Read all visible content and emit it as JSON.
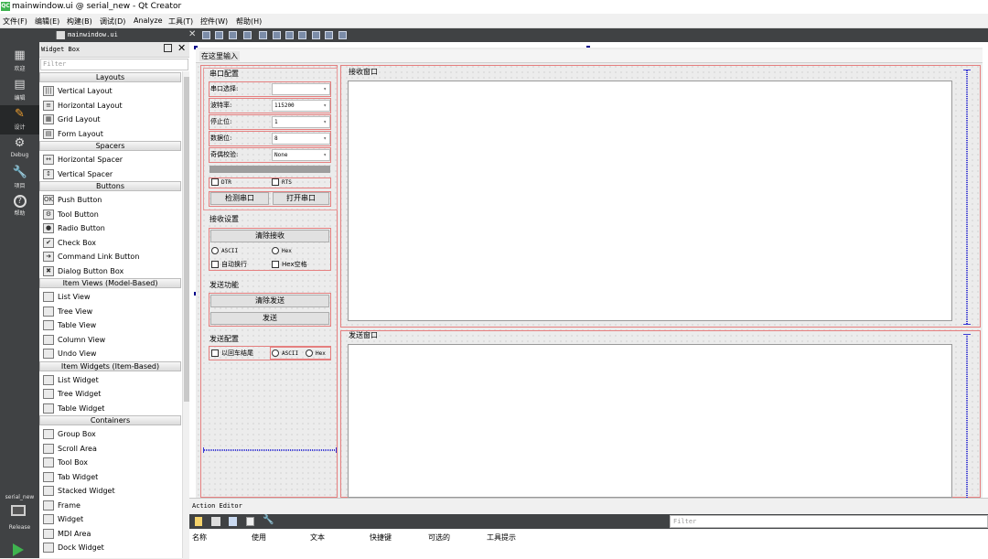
{
  "window": {
    "logo": "QC",
    "title": "mainwindow.ui @ serial_new - Qt Creator"
  },
  "menu": [
    "文件(F)",
    "编辑(E)",
    "构建(B)",
    "调试(D)",
    "Analyze",
    "工具(T)",
    "控件(W)",
    "帮助(H)"
  ],
  "modes": [
    {
      "label": "欢迎",
      "icon": "▦"
    },
    {
      "label": "编辑",
      "icon": "▤"
    },
    {
      "label": "设计",
      "icon": "✎"
    },
    {
      "label": "Debug",
      "icon": "⚙"
    },
    {
      "label": "项目",
      "icon": "🔧"
    },
    {
      "label": "帮助",
      "icon": "?"
    }
  ],
  "project": {
    "name": "serial_new",
    "config": "Release"
  },
  "editor_tab": {
    "filename": "mainwindow.ui"
  },
  "widget_box": {
    "title": "Widget Box",
    "filter_placeholder": "Filter",
    "categories": [
      {
        "name": "Layouts",
        "items": [
          "Vertical Layout",
          "Horizontal Layout",
          "Grid Layout",
          "Form Layout"
        ]
      },
      {
        "name": "Spacers",
        "items": [
          "Horizontal Spacer",
          "Vertical Spacer"
        ]
      },
      {
        "name": "Buttons",
        "items": [
          "Push Button",
          "Tool Button",
          "Radio Button",
          "Check Box",
          "Command Link Button",
          "Dialog Button Box"
        ]
      },
      {
        "name": "Item Views (Model-Based)",
        "items": [
          "List View",
          "Tree View",
          "Table View",
          "Column View",
          "Undo View"
        ]
      },
      {
        "name": "Item Widgets (Item-Based)",
        "items": [
          "List Widget",
          "Tree Widget",
          "Table Widget"
        ]
      },
      {
        "name": "Containers",
        "items": [
          "Group Box",
          "Scroll Area",
          "Tool Box",
          "Tab Widget",
          "Stacked Widget",
          "Frame",
          "Widget",
          "MDI Area",
          "Dock Widget"
        ]
      }
    ]
  },
  "form": {
    "menu_placeholder": "在这里输入",
    "serial_group": {
      "title": "串口配置",
      "rows": [
        {
          "label": "串口选择:",
          "value": ""
        },
        {
          "label": "波特率:",
          "value": "115200"
        },
        {
          "label": "停止位:",
          "value": "1"
        },
        {
          "label": "数据位:",
          "value": "8"
        },
        {
          "label": "奇偶校验:",
          "value": "None"
        }
      ],
      "dtr": "DTR",
      "rts": "RTS",
      "detect_btn": "检测串口",
      "open_btn": "打开串口"
    },
    "recv_group": {
      "title": "接收设置",
      "clear_btn": "清除接收",
      "ascii": "ASCII",
      "hex": "Hex",
      "autowrap": "自动换行",
      "hexspace": "Hex空格"
    },
    "send_func": {
      "title": "发送功能",
      "clear_btn": "清除发送",
      "send_btn": "发送"
    },
    "send_cfg": {
      "title": "发送配置",
      "enter_end": "以回车结尾",
      "ascii": "ASCII",
      "hex": "Hex"
    },
    "recv_window": {
      "title": "接收窗口"
    },
    "send_window": {
      "title": "发送窗口"
    }
  },
  "action_editor": {
    "title": "Action Editor",
    "filter_placeholder": "Filter",
    "columns": [
      "名称",
      "使用",
      "文本",
      "快捷键",
      "可选的",
      "工具提示"
    ]
  }
}
